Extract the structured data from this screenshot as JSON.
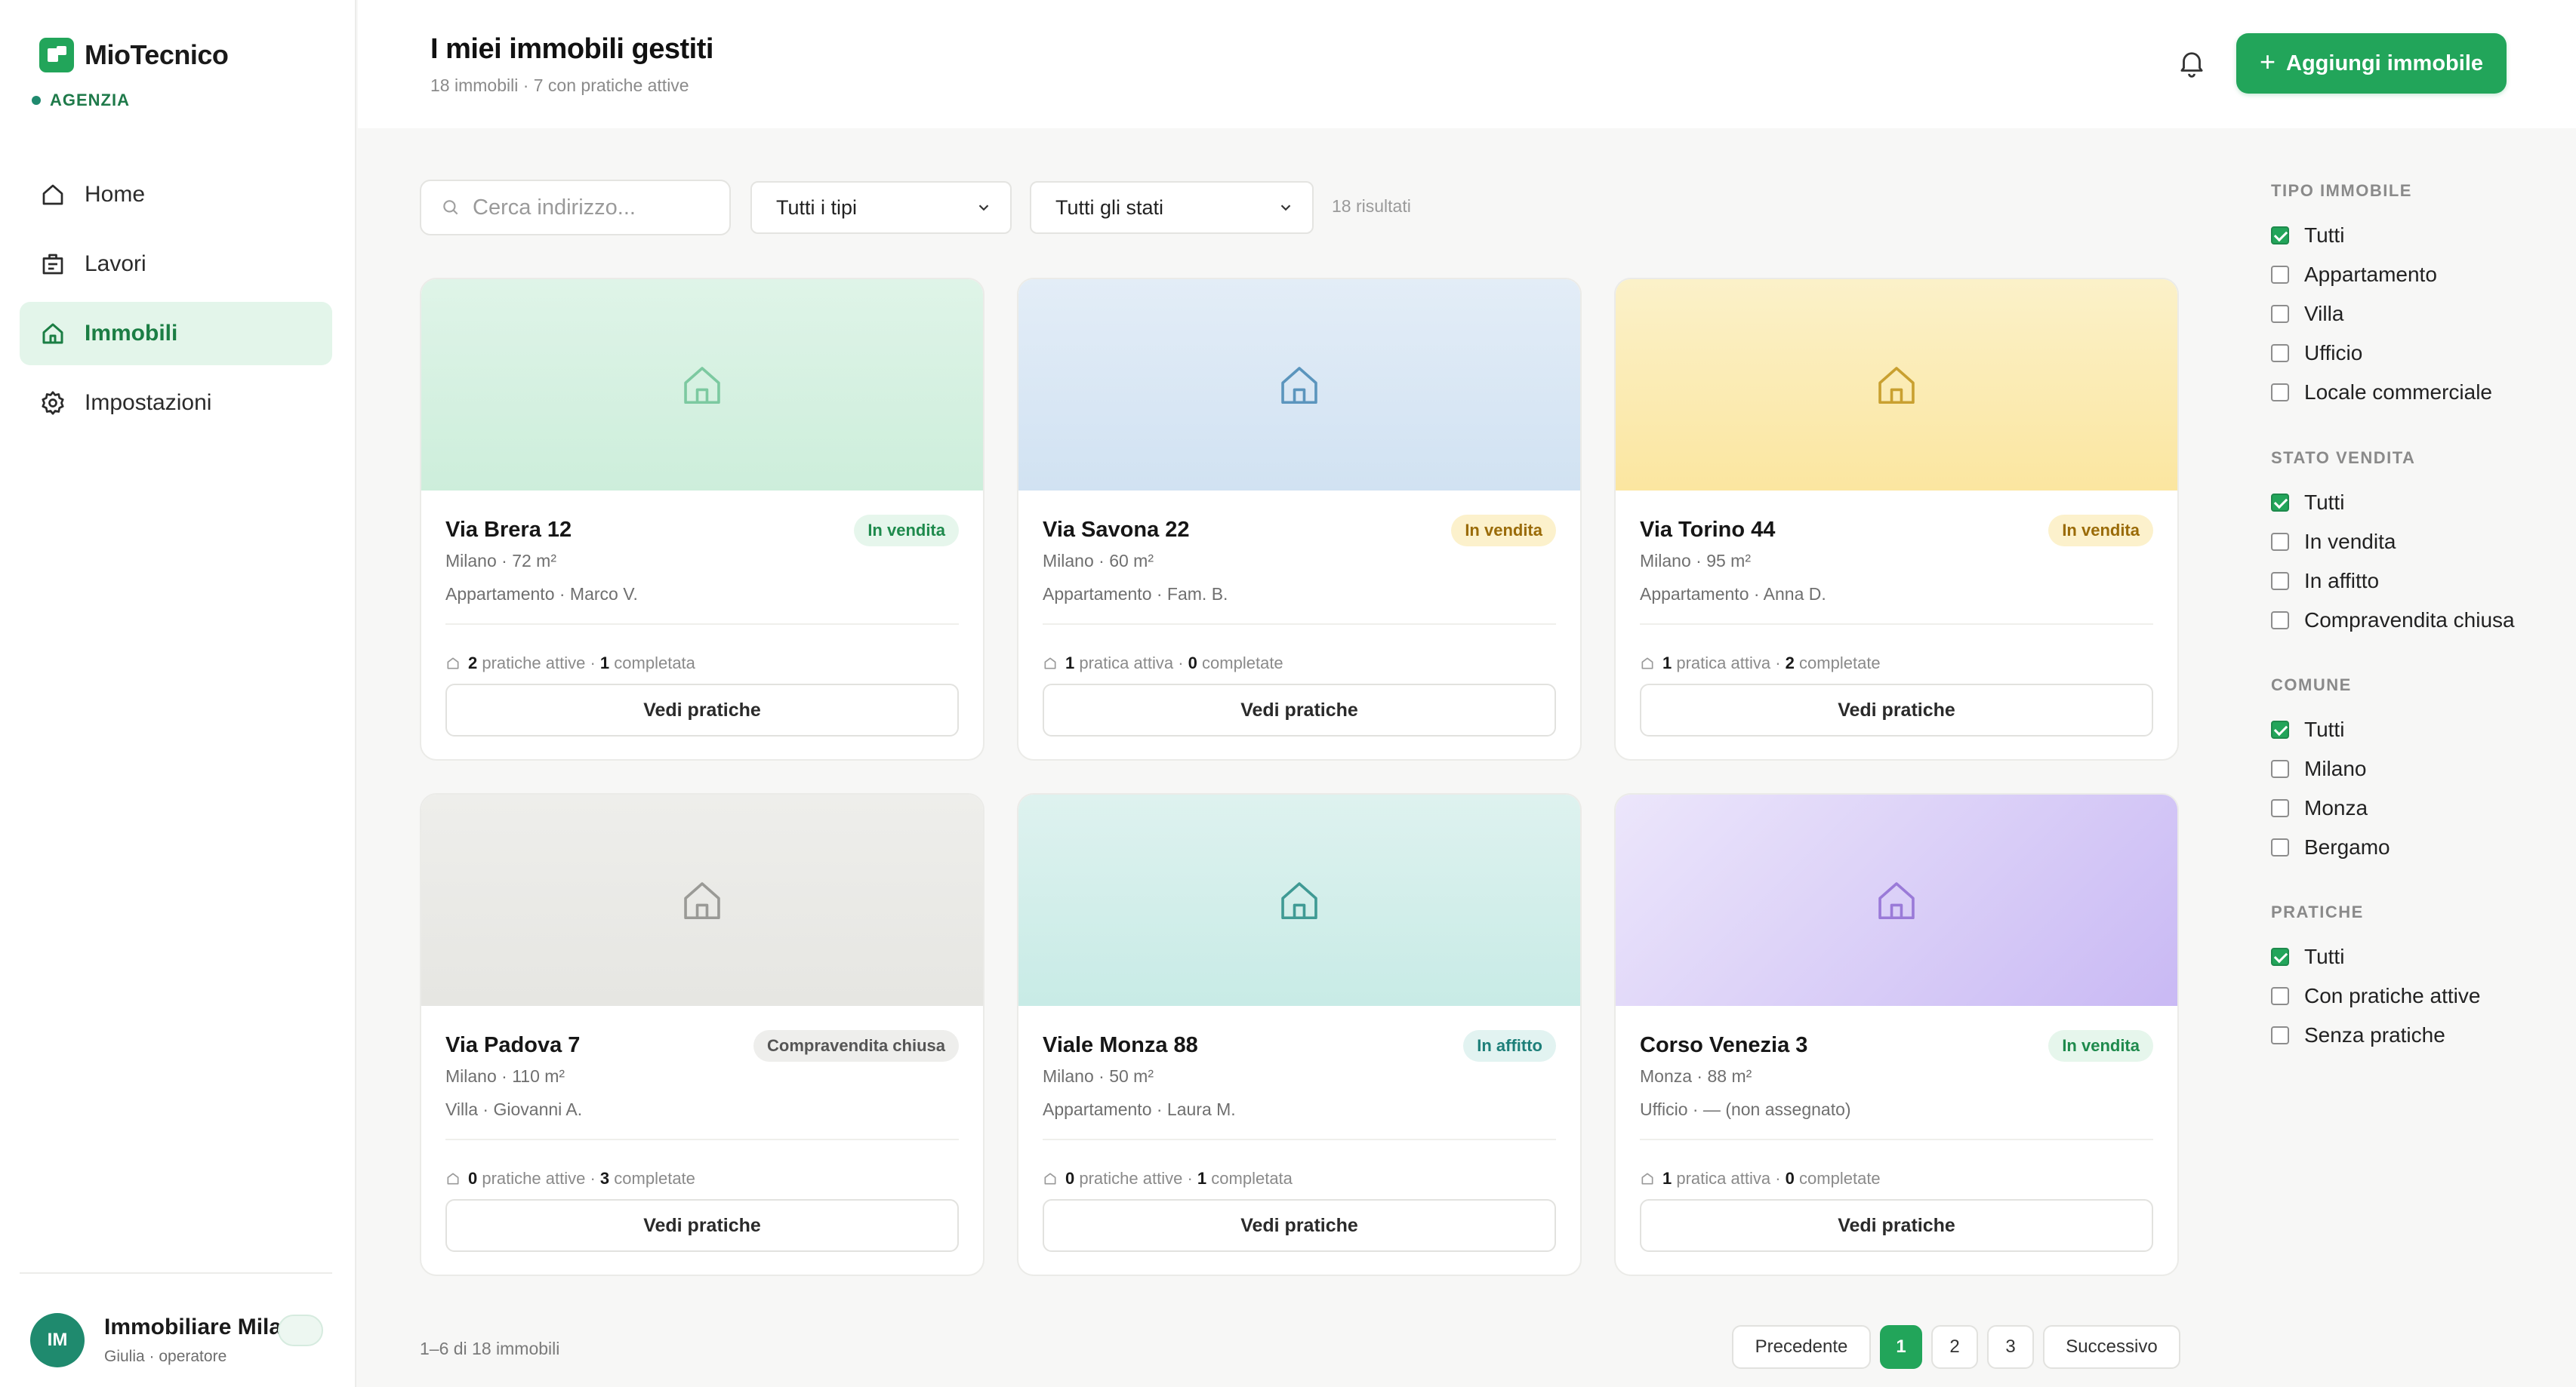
{
  "app": {
    "name": "MioTecnico",
    "org_tag": "AGENZIA"
  },
  "nav": [
    {
      "label": "Home",
      "icon": "home-icon"
    },
    {
      "label": "Lavori",
      "icon": "briefcase-icon"
    },
    {
      "label": "Immobili",
      "icon": "building-icon",
      "active": true
    },
    {
      "label": "Impostazioni",
      "icon": "gear-icon"
    }
  ],
  "user": {
    "initials": "IM",
    "name": "Immobiliare Milano",
    "role": "Giulia · operatore"
  },
  "header": {
    "title": "I miei immobili gestiti",
    "subtitle": "18 immobili · 7 con pratiche attive",
    "add_label": "Aggiungi immobile"
  },
  "filters": {
    "search_placeholder": "Cerca indirizzo...",
    "type_value": "Tutti i tipi",
    "state_value": "Tutti gli stati",
    "results": "18 risultati"
  },
  "cards": [
    {
      "title": "Via Brera 12",
      "badge": "In vendita",
      "badge_style": "green",
      "city": "Milano · 72 m²",
      "meta": "Appartamento · Marco V.",
      "active_n": "2",
      "active_label": "pratiche attive",
      "done_n": "1",
      "done_label": "completata",
      "button": "Vedi pratiche",
      "theme": "green",
      "icon_color": "#7cc9a0"
    },
    {
      "title": "Via Savona 22",
      "badge": "In vendita",
      "badge_style": "yellow",
      "city": "Milano · 60 m²",
      "meta": "Appartamento · Fam. B.",
      "active_n": "1",
      "active_label": "pratica attiva",
      "done_n": "0",
      "done_label": "completate",
      "button": "Vedi pratiche",
      "theme": "blue",
      "icon_color": "#5b95bd"
    },
    {
      "title": "Via Torino 44",
      "badge": "In vendita",
      "badge_style": "yellow",
      "city": "Milano · 95 m²",
      "meta": "Appartamento · Anna D.",
      "active_n": "1",
      "active_label": "pratica attiva",
      "done_n": "2",
      "done_label": "completate",
      "button": "Vedi pratiche",
      "theme": "yellow",
      "icon_color": "#c9a030"
    },
    {
      "title": "Via Padova 7",
      "badge": "Compravendita chiusa",
      "badge_style": "gray",
      "city": "Milano · 110 m²",
      "meta": "Villa · Giovanni A.",
      "active_n": "0",
      "active_label": "pratiche attive",
      "done_n": "3",
      "done_label": "completate",
      "button": "Vedi pratiche",
      "theme": "gray",
      "icon_color": "#9a9a96"
    },
    {
      "title": "Viale Monza 88",
      "badge": "In affitto",
      "badge_style": "teal",
      "city": "Milano · 50 m²",
      "meta": "Appartamento · Laura M.",
      "active_n": "0",
      "active_label": "pratiche attive",
      "done_n": "1",
      "done_label": "completata",
      "button": "Vedi pratiche",
      "theme": "teal",
      "icon_color": "#3f9a94"
    },
    {
      "title": "Corso Venezia 3",
      "badge": "In vendita",
      "badge_style": "green",
      "city": "Monza · 88 m²",
      "meta": "Ufficio · — (non assegnato)",
      "active_n": "1",
      "active_label": "pratica attiva",
      "done_n": "0",
      "done_label": "completate",
      "button": "Vedi pratiche",
      "theme": "purple",
      "icon_color": "#9a7ad8"
    }
  ],
  "pagination": {
    "range": "1–6 di 18 immobili",
    "prev": "Precedente",
    "pages": [
      "1",
      "2",
      "3"
    ],
    "current": "1",
    "next": "Successivo"
  },
  "panel": [
    {
      "heading": "TIPO IMMOBILE",
      "options": [
        {
          "label": "Tutti",
          "checked": true
        },
        {
          "label": "Appartamento",
          "checked": false
        },
        {
          "label": "Villa",
          "checked": false
        },
        {
          "label": "Ufficio",
          "checked": false
        },
        {
          "label": "Locale commerciale",
          "checked": false
        }
      ]
    },
    {
      "heading": "STATO VENDITA",
      "options": [
        {
          "label": "Tutti",
          "checked": true
        },
        {
          "label": "In vendita",
          "checked": false
        },
        {
          "label": "In affitto",
          "checked": false
        },
        {
          "label": "Compravendita chiusa",
          "checked": false
        }
      ]
    },
    {
      "heading": "COMUNE",
      "options": [
        {
          "label": "Tutti",
          "checked": true
        },
        {
          "label": "Milano",
          "checked": false
        },
        {
          "label": "Monza",
          "checked": false
        },
        {
          "label": "Bergamo",
          "checked": false
        }
      ]
    },
    {
      "heading": "PRATICHE",
      "options": [
        {
          "label": "Tutti",
          "checked": true
        },
        {
          "label": "Con pratiche attive",
          "checked": false
        },
        {
          "label": "Senza pratiche",
          "checked": false
        }
      ]
    }
  ],
  "colors": {
    "accent": "#22a55a",
    "accent_dark": "#1b7e44",
    "accent_soft": "#e3f5ea"
  }
}
